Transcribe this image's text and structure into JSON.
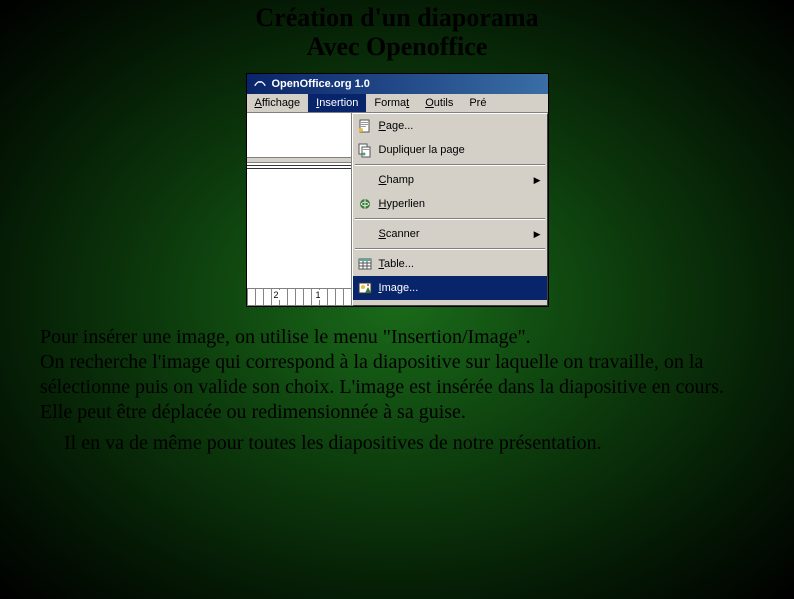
{
  "title_line1": "Création d'un diaporama",
  "title_line2": "Avec Openoffice",
  "window": {
    "title": "OpenOffice.org 1.0",
    "menu": {
      "affichage": "Affichage",
      "insertion": "Insertion",
      "format": "Format",
      "outils": "Outils",
      "pre": "Pré"
    },
    "ruler_num": "2",
    "ruler_num2": "1",
    "dropdown": {
      "page": "Page...",
      "dupliquer": "Dupliquer la page",
      "champ": "Champ",
      "hyperlien": "Hyperlien",
      "scanner": "Scanner",
      "table": "Table...",
      "image": "Image..."
    }
  },
  "paragraph1": "Pour insérer une image, on utilise le menu \"Insertion/Image\".",
  "paragraph2": "On recherche l'image qui correspond à la diapositive sur laquelle on travaille, on la sélectionne puis on valide son choix. L'image est insérée dans la diapositive en cours. Elle peut être déplacée ou redimensionnée à sa guise.",
  "paragraph3": "Il en va de même pour toutes les diapositives de notre présentation."
}
